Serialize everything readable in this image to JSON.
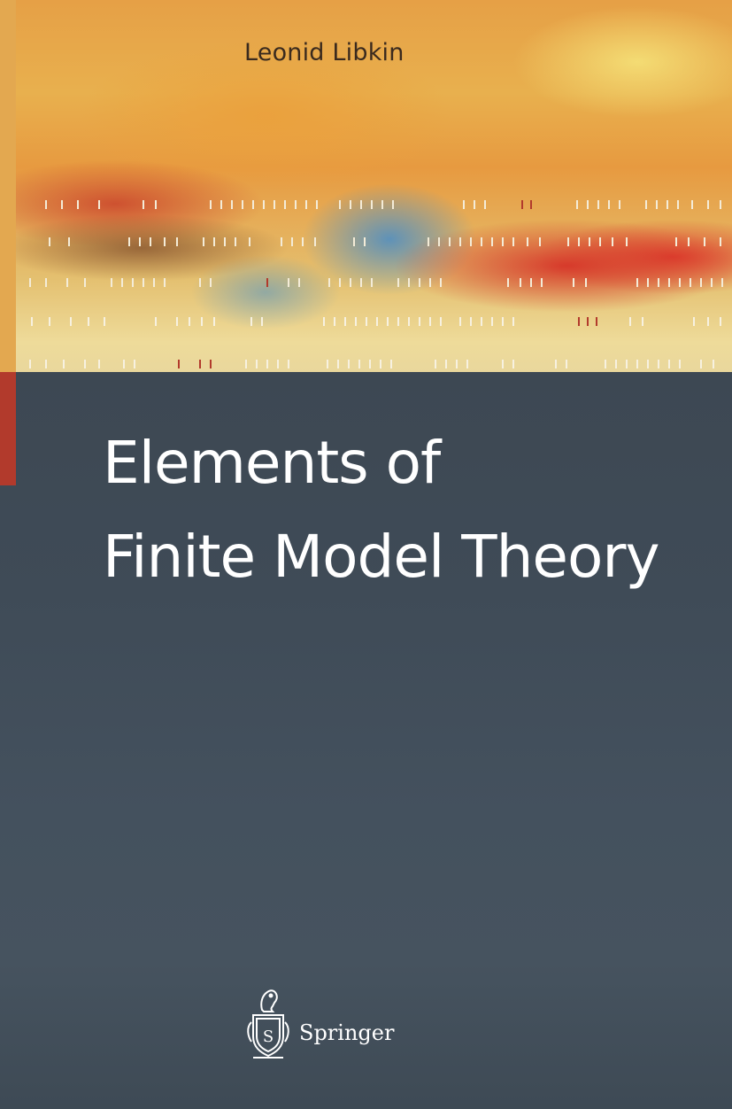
{
  "cover": {
    "author": "Leonid Libkin",
    "title_lines": [
      "Elements of",
      "Finite Model Theory"
    ],
    "publisher": "Springer",
    "logo_icon": "springer-knight-logo-icon",
    "colors": {
      "art_orange": "#e6a046",
      "art_red": "#d63428",
      "art_blue": "#468cc8",
      "lower_slate": "#3f4b57",
      "title_text": "#ffffff",
      "author_text": "#3a2a1e",
      "accent_red_strip": "#b23a2c"
    }
  }
}
